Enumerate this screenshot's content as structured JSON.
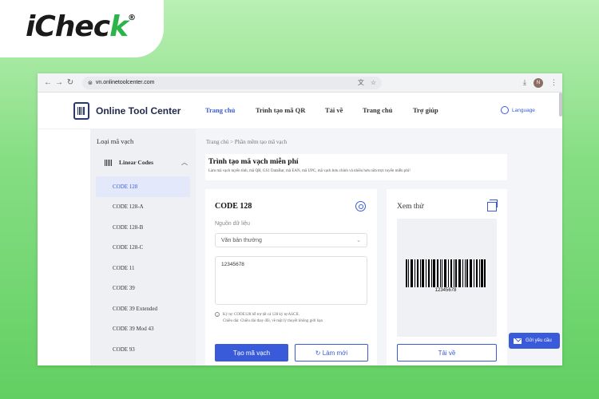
{
  "logo": {
    "text": "iChec",
    "accent": "k",
    "reg": "®"
  },
  "browser": {
    "url": "vn.onlinetoolcenter.com",
    "profile_initial": "N"
  },
  "site": {
    "brand": "Online Tool Center",
    "menu": [
      "Trang chủ",
      "Trình tạo mã QR",
      "Tải về",
      "Trang chủ",
      "Trợ giúp"
    ],
    "language": "Language"
  },
  "sidebar": {
    "title": "Loại mã vạch",
    "group": "Linear Codes",
    "items": [
      "CODE 128",
      "CODE 128-A",
      "CODE 128-B",
      "CODE 128-C",
      "CODE 11",
      "CODE 39",
      "CODE 39 Extended",
      "CODE 39 Mod 43",
      "CODE 93"
    ]
  },
  "main": {
    "breadcrumb": "Trang chủ > Phần mềm tạo mã vạch",
    "title": "Trình tạo mã vạch miễn phí",
    "subtitle": "Làm mã vạch tuyến tính, mã QR, GS1 DataBar, mã EAN, mã UPC, mã vạch bưu chính và nhiều hơn nữa trực tuyến miễn phí!",
    "generator": {
      "heading": "CODE 128",
      "source_label": "Nguồn dữ liệu",
      "source_value": "Văn bản thường",
      "input_value": "12345678",
      "note1": "Ký tự: CODE128 hỗ trợ tất cả 128 ký tự ASCII.",
      "note2": "Chiều dài: Chiều dài thay đổi, về mặt lý thuyết không giới hạn",
      "create_label": "Tạo mã vạch",
      "refresh_label": "↻ Làm mới"
    },
    "preview": {
      "heading": "Xem thử",
      "barcode_text": "12345678",
      "download_label": "Tải về"
    }
  },
  "support": {
    "label": "Gửi yêu cầu"
  },
  "colors": {
    "accent": "#3a5bd9",
    "logo_green": "#2cb34a"
  }
}
